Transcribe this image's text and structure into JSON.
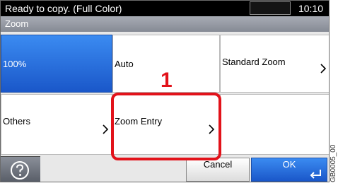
{
  "status": {
    "message": "Ready to copy. (Full Color)",
    "time": "10:10"
  },
  "title": "Zoom",
  "options": {
    "p100": "100%",
    "auto": "Auto",
    "standard_zoom": "Standard Zoom",
    "others": "Others",
    "zoom_entry": "Zoom Entry"
  },
  "annotation": {
    "step": "1"
  },
  "buttons": {
    "cancel": "Cancel",
    "ok": "OK"
  },
  "icons": [
    "question-mark-icon",
    "chevron-right-icon",
    "enter-icon"
  ],
  "colors": {
    "selected": "#1a57c9",
    "highlight": "#e2121a",
    "status_bar": "#000000"
  },
  "figure_code": "GB0005_00"
}
